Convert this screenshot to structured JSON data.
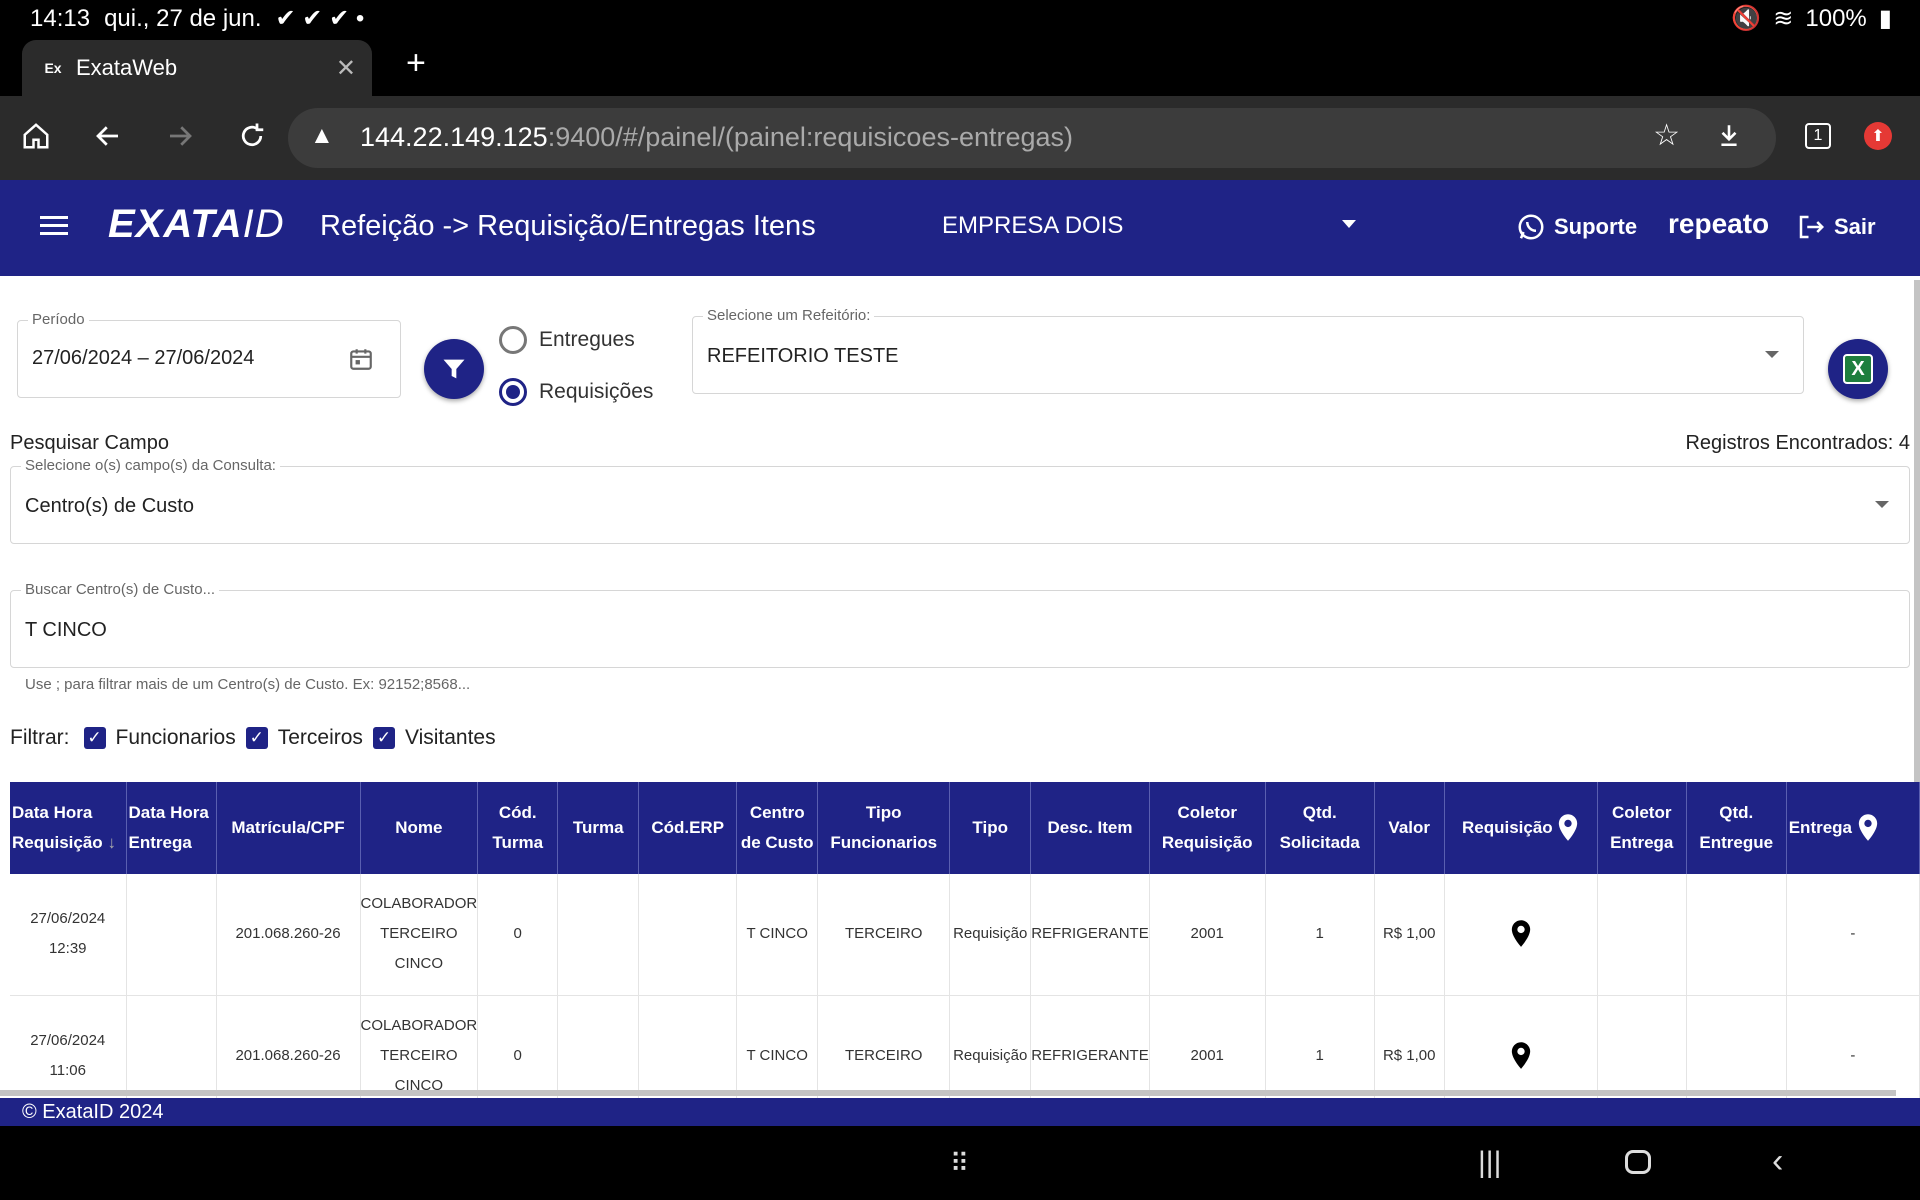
{
  "status_bar": {
    "time": "14:13",
    "date": "qui., 27 de jun.",
    "battery": "100%"
  },
  "browser": {
    "tab_title": "ExataWeb",
    "tab_favicon": "Ex",
    "url_host": "144.22.149.125",
    "url_path": ":9400/#/painel/(painel:requisicoes-entregas)",
    "tab_count": "1"
  },
  "header": {
    "logo": "EXATA",
    "logo_suffix": "ID",
    "title": "Refeição -> Requisição/Entregas Itens",
    "company": "EMPRESA DOIS",
    "support_label": "Suporte",
    "user": "repeato",
    "logout_label": "Sair"
  },
  "filters": {
    "period_label": "Período",
    "period_value": "27/06/2024 – 27/06/2024",
    "radio_delivered": "Entregues",
    "radio_requests": "Requisições",
    "selected_radio": "Requisições",
    "refectory_label": "Selecione um Refeitório:",
    "refectory_value": "REFEITORIO TESTE",
    "search_field_title": "Pesquisar Campo",
    "records_found": "Registros Encontrados: 4",
    "fields_label": "Selecione o(s) campo(s) da Consulta:",
    "fields_value": "Centro(s) de Custo",
    "search_label": "Buscar Centro(s) de Custo...",
    "search_value": "T CINCO",
    "hint": "Use ; para filtrar mais de um Centro(s) de Custo. Ex: 92152;8568...",
    "filter_label": "Filtrar:",
    "checkboxes": [
      "Funcionarios",
      "Terceiros",
      "Visitantes"
    ]
  },
  "table": {
    "headers": [
      "Data Hora Requisição",
      "Data Hora Entrega",
      "Matrícula/CPF",
      "Nome",
      "Cód. Turma",
      "Turma",
      "Cód.ERP",
      "Centro de Custo",
      "Tipo Funcionarios",
      "Tipo",
      "Desc. Item",
      "Coletor Requisição",
      "Qtd. Solicitada",
      "Valor",
      "Requisição",
      "Coletor Entrega",
      "Qtd. Entregue",
      "Entrega"
    ],
    "rows": [
      {
        "req_date": "27/06/2024",
        "req_time": "12:39",
        "delivery": "",
        "cpf": "201.068.260-26",
        "name": "COLABORADOR TERCEIRO CINCO",
        "turma_code": "0",
        "turma": "",
        "erp": "",
        "cost_center": "T CINCO",
        "emp_type": "TERCEIRO",
        "type": "Requisição",
        "item": "REFRIGERANTE",
        "collector_req": "2001",
        "qty_req": "1",
        "value": "R$ 1,00",
        "collector_del": "",
        "qty_del": "",
        "delivery_loc": "-"
      },
      {
        "req_date": "27/06/2024",
        "req_time": "11:06",
        "delivery": "",
        "cpf": "201.068.260-26",
        "name": "COLABORADOR TERCEIRO CINCO",
        "turma_code": "0",
        "turma": "",
        "erp": "",
        "cost_center": "T CINCO",
        "emp_type": "TERCEIRO",
        "type": "Requisição",
        "item": "REFRIGERANTE",
        "collector_req": "2001",
        "qty_req": "1",
        "value": "R$ 1,00",
        "collector_del": "",
        "qty_del": "",
        "delivery_loc": "-"
      }
    ]
  },
  "footer": "© ExataID 2024",
  "colors": {
    "primary": "#1f2386",
    "excel_green": "#1e7e3e"
  }
}
